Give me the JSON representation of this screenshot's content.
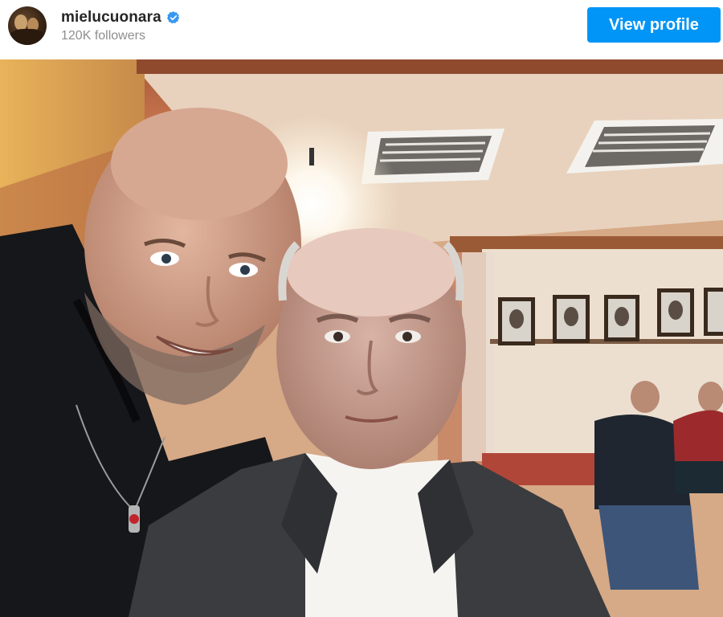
{
  "post_header": {
    "username": "mielucuonara",
    "followers": "120K followers",
    "view_profile_label": "View profile",
    "verified": true,
    "accent_color": "#0095f6"
  }
}
